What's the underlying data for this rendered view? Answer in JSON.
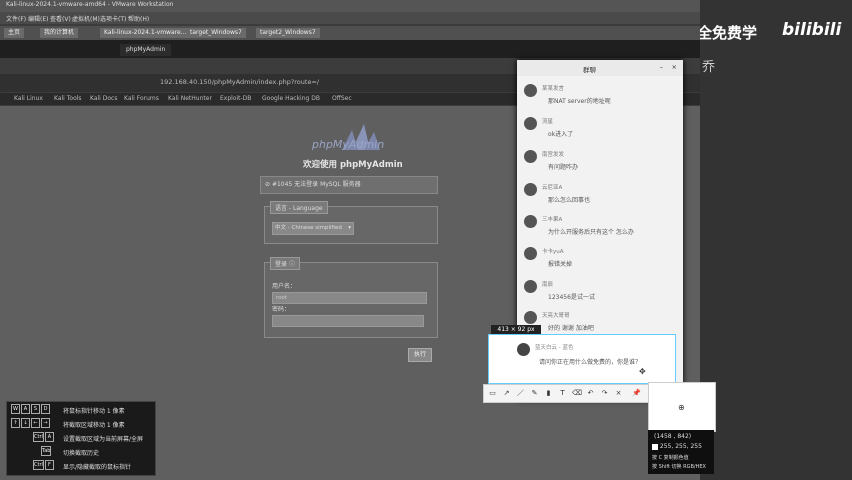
{
  "overlay": {
    "brand": "网络安全免费学",
    "bili_logo": "bilibili",
    "side_char": "乔"
  },
  "vmware": {
    "title": "Kali-linux-2024.1-vmware-amd64 - VMware Workstation",
    "menu": [
      "文件(F)",
      "编辑(E)",
      "查看(V)",
      "虚拟机(M)",
      "选项卡(T)",
      "帮助(H)"
    ],
    "tabs": [
      "主页",
      "我的计算机",
      "Kali-linux-2024.1-vmware...",
      "target_Windows7",
      "target2_Windows7"
    ]
  },
  "browser": {
    "tab": "phpMyAdmin",
    "url": "192.168.40.150/phpMyAdmin/index.php?route=/",
    "bookmarks": [
      "Kali Linux",
      "Kali Tools",
      "Kali Docs",
      "Kali Forums",
      "Kali NetHunter",
      "Exploit-DB",
      "Google Hacking DB",
      "OffSec"
    ]
  },
  "pma": {
    "logo": "phpMyAdmin",
    "welcome": "欢迎使用 phpMyAdmin",
    "error": "#1045 无法登录 MySQL 服务器",
    "language_legend": "语言 - Language",
    "language_value": "中文 - Chinese simplified",
    "login_legend": "登录",
    "username_label": "用户名：",
    "username_value": "root",
    "password_label": "密码：",
    "go_button": "执行"
  },
  "qq": {
    "title": "群聊",
    "messages": [
      {
        "name": "某某发言",
        "text": "那NAT server的地址呢"
      },
      {
        "name": "流星",
        "text": "ok进入了"
      },
      {
        "name": "南宫发发",
        "text": "有问题咋办"
      },
      {
        "name": "云尼亚A",
        "text": "那么怎么回事也"
      },
      {
        "name": "三丰果A",
        "text": "为什么开服务后只有这个 怎么办"
      },
      {
        "name": "卡卡yuA",
        "text": "报错关掉"
      },
      {
        "name": "南辰",
        "text": "123456是试一试"
      },
      {
        "name": "天亮大哥哥",
        "text": "好的 谢谢 加油吧"
      }
    ]
  },
  "screenshot_tool": {
    "selection_size": "413 × 92 px",
    "selection_name": "蓝天白云 - 蓝色",
    "selection_text": "请问你正在用什么做免费的，你是谁？",
    "coords": "(1458 , 842)",
    "rgb": "255, 255, 255",
    "copy_hint": "按 C 复制颜色值",
    "shift_hint": "按 Shift 切换 RGB/HEX"
  },
  "hint_panel": {
    "rows": [
      {
        "keys": [
          "W",
          "A",
          "S",
          "D"
        ],
        "desc": "将鼠标指针移动 1 像素"
      },
      {
        "keys": [
          "↑",
          "↓",
          "←",
          "→"
        ],
        "desc": "将截取区域移动 1 像素"
      },
      {
        "keys": [
          "Ctrl",
          "A"
        ],
        "desc": "设置截取区域为当前屏幕/全屏"
      },
      {
        "keys": [
          "Tab"
        ],
        "desc": "切换截取历史"
      },
      {
        "keys": [
          "Ctrl",
          "F"
        ],
        "desc": "显示/隐藏截取的鼠标指针"
      }
    ]
  }
}
